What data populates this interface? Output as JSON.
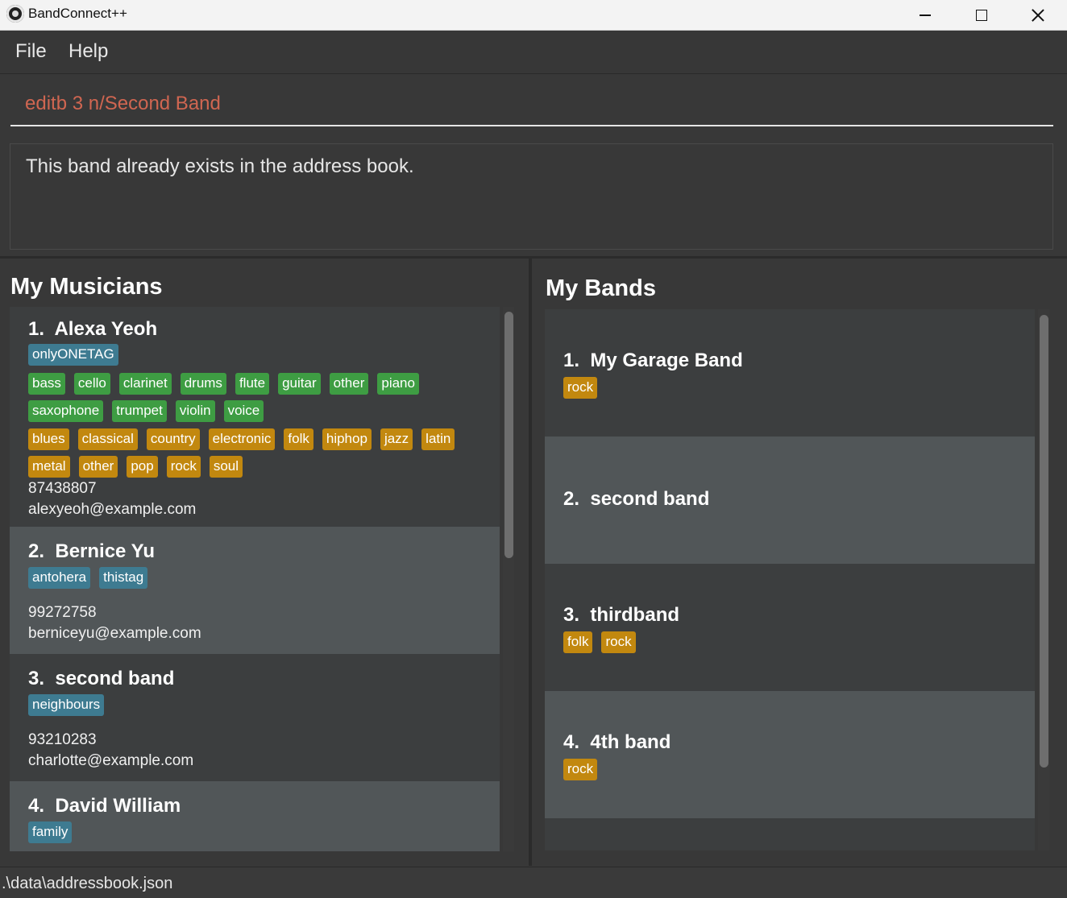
{
  "window": {
    "title": "BandConnect++"
  },
  "menu": {
    "file": "File",
    "help": "Help"
  },
  "command": {
    "value": "editb 3 n/Second Band"
  },
  "result": {
    "message": "This band already exists in the address book."
  },
  "musicians": {
    "title": "My Musicians",
    "items": [
      {
        "index": "1.",
        "name": "Alexa Yeoh",
        "tags": [
          "onlyONETAG"
        ],
        "instruments": [
          "bass",
          "cello",
          "clarinet",
          "drums",
          "flute",
          "guitar",
          "other",
          "piano",
          "saxophone",
          "trumpet",
          "violin",
          "voice"
        ],
        "genres": [
          "blues",
          "classical",
          "country",
          "electronic",
          "folk",
          "hiphop",
          "jazz",
          "latin",
          "metal",
          "other",
          "pop",
          "rock",
          "soul"
        ],
        "phone": "87438807",
        "email": "alexyeoh@example.com"
      },
      {
        "index": "2.",
        "name": "Bernice Yu",
        "tags": [
          "antohera",
          "thistag"
        ],
        "instruments": [],
        "genres": [],
        "phone": "99272758",
        "email": "berniceyu@example.com"
      },
      {
        "index": "3.",
        "name": "second band",
        "tags": [
          "neighbours"
        ],
        "instruments": [],
        "genres": [],
        "phone": "93210283",
        "email": "charlotte@example.com"
      },
      {
        "index": "4.",
        "name": "David William",
        "tags": [
          "family"
        ],
        "instruments": [],
        "genres": [],
        "phone": "",
        "email": ""
      }
    ]
  },
  "bands": {
    "title": "My Bands",
    "items": [
      {
        "index": "1.",
        "name": "My Garage Band",
        "genres": [
          "rock"
        ]
      },
      {
        "index": "2.",
        "name": "second band",
        "genres": []
      },
      {
        "index": "3.",
        "name": "thirdband",
        "genres": [
          "folk",
          "rock"
        ]
      },
      {
        "index": "4.",
        "name": "4th band",
        "genres": [
          "rock"
        ]
      }
    ]
  },
  "status": {
    "path": ".\\data\\addressbook.json"
  },
  "colors": {
    "tag_blue": "#3e7b91",
    "tag_green": "#3e9d43",
    "tag_orange": "#c2880f",
    "command_text": "#d06651"
  }
}
